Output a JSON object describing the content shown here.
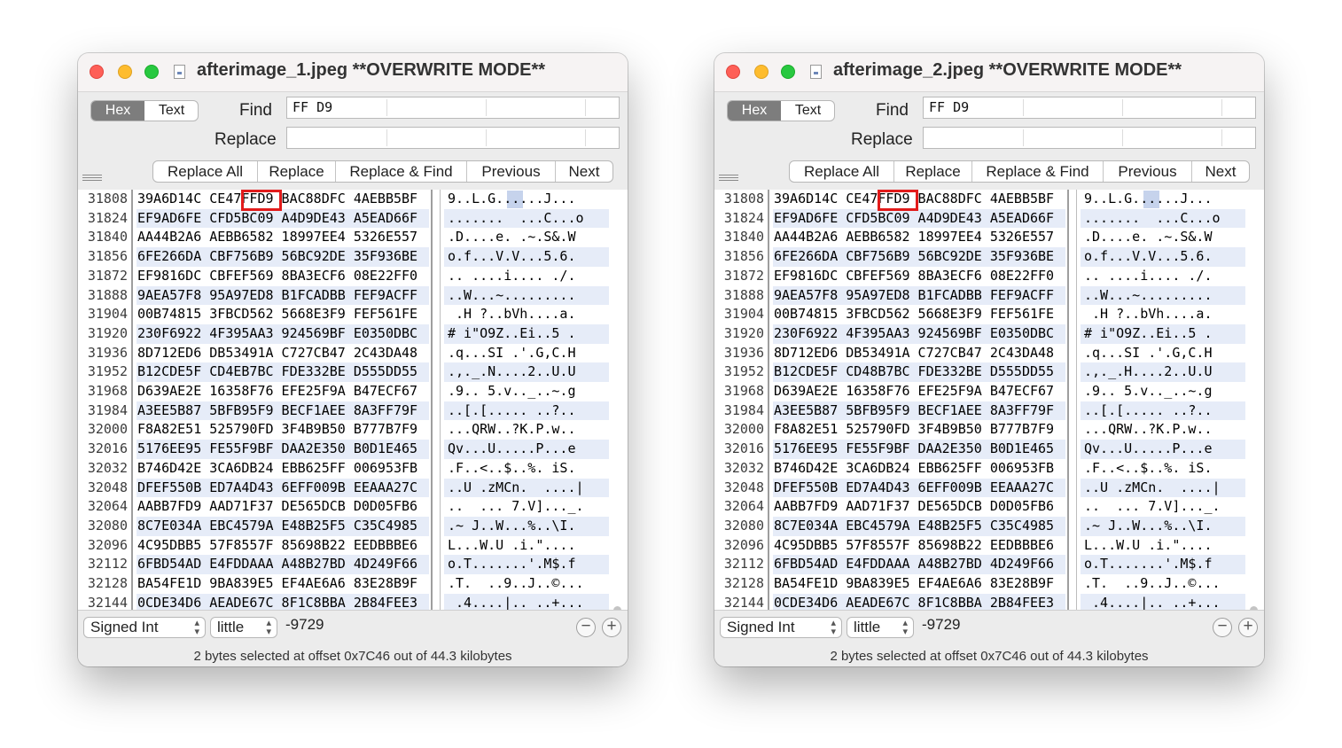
{
  "hex_rows": [
    [
      "31808",
      "39A6D14C CE47FFD9 BAC88DFC 4AEBB5BF",
      "9..L.G......J..."
    ],
    [
      "31824",
      "EF9AD6FE CFD5BC09 A4D9DE43 A5EAD66F",
      ".......  ...C...o"
    ],
    [
      "31840",
      "AA44B2A6 AEBB6582 18997EE4 5326E557",
      ".D....e. .~.S&.W"
    ],
    [
      "31856",
      "6FE266DA CBF756B9 56BC92DE 35F936BE",
      "o.f...V.V...5.6."
    ],
    [
      "31872",
      "EF9816DC CBFEF569 8BA3ECF6 08E22FF0",
      ".. ....i.... ./."
    ],
    [
      "31888",
      "9AEA57F8 95A97ED8 B1FCADBB FEF9ACFF",
      "..W...~........."
    ],
    [
      "31904",
      "00B74815 3FBCD562 5668E3F9 FEF561FE",
      " .H ?..bVh....a."
    ],
    [
      "31920",
      "230F6922 4F395AA3 924569BF E0350DBC",
      "# i\"O9Z..Ei..5 ."
    ],
    [
      "31936",
      "8D712ED6 DB53491A C727CB47 2C43DA48",
      ".q...SI .'.G,C.H"
    ],
    [
      "31952",
      "B12CDE5F CD4EB7BC FDE332BE D555DD55",
      ".,._.N....2..U.U"
    ],
    [
      "31968",
      "D639AE2E 16358F76 EFE25F9A B47ECF67",
      ".9.. 5.v.._..~.g"
    ],
    [
      "31984",
      "A3EE5B87 5BFB95F9 BECF1AEE 8A3FF79F",
      "..[.[..... ..?.."
    ],
    [
      "32000",
      "F8A82E51 525790FD 3F4B9B50 B777B7F9",
      "...QRW..?K.P.w.."
    ],
    [
      "32016",
      "5176EE95 FE55F9BF DAA2E350 B0D1E465",
      "Qv...U.....P...e"
    ],
    [
      "32032",
      "B746D42E 3CA6DB24 EBB625FF 006953FB",
      ".F..<..$..%. iS."
    ],
    [
      "32048",
      "DFEF550B ED7A4D43 6EFF009B EEAAA27C",
      "..U .zMCn.  ....|"
    ],
    [
      "32064",
      "AABB7FD9 AAD71F37 DE565DCB D0D05FB6",
      "..  ... 7.V]..._."
    ],
    [
      "32080",
      "8C7E034A EBC4579A E48B25F5 C35C4985",
      ".~ J..W...%..\\I."
    ],
    [
      "32096",
      "4C95DBB5 57F8557F 85698B22 EEDBBBE6",
      "L...W.U .i.\"...."
    ],
    [
      "32112",
      "6FBD54AD E4FDDAAA A48B27BD 4D249F66",
      "o.T.......'.M$.f"
    ],
    [
      "32128",
      "BA54FE1D 9BA839E5 EF4AE6A6 83E28B9F",
      ".T.  ..9..J..©..."
    ],
    [
      "32144",
      "0CDE34D6 AEADE67C 8F1C8BBA 2B84FEE3",
      " .4....|.. ..+..."
    ]
  ],
  "hex_rows_right_diff": {
    "9": [
      "31952",
      "B12CDE5F CD48B7BC FDE332BE D555DD55",
      ".,._.H....2..U.U"
    ]
  },
  "windows": [
    {
      "title": "afterimage_1.jpeg **OVERWRITE MODE**",
      "mode_hex": "Hex",
      "mode_text": "Text",
      "find_label": "Find",
      "find_value": "FF D9",
      "replace_label": "Replace",
      "replace_value": "",
      "buttons": [
        "Replace All",
        "Replace",
        "Replace & Find",
        "Previous",
        "Next"
      ],
      "type_select": "Signed Int",
      "endian_select": "little",
      "value": "-9729",
      "minus": "−",
      "plus": "+",
      "status": "2 bytes selected at offset 0x7C46 out of 44.3 kilobytes"
    },
    {
      "title": "afterimage_2.jpeg **OVERWRITE MODE**",
      "mode_hex": "Hex",
      "mode_text": "Text",
      "find_label": "Find",
      "find_value": "FF D9",
      "replace_label": "Replace",
      "replace_value": "",
      "buttons": [
        "Replace All",
        "Replace",
        "Replace & Find",
        "Previous",
        "Next"
      ],
      "type_select": "Signed Int",
      "endian_select": "little",
      "value": "-9729",
      "minus": "−",
      "plus": "+",
      "status": "2 bytes selected at offset 0x7C46 out of 44.3 kilobytes"
    }
  ],
  "colors": {
    "highlight_box": "#e21b1b",
    "alt_row": "#e6ecf8",
    "selection": "#c6d3ec"
  }
}
